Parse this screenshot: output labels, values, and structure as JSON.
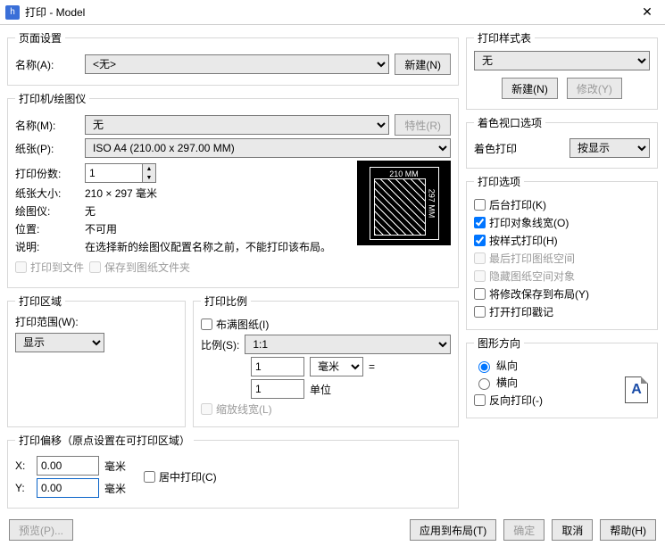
{
  "window": {
    "title": "打印 - Model",
    "icon": "h"
  },
  "page_setup": {
    "legend": "页面设置",
    "name_label": "名称(A):",
    "name_value": "<无>",
    "new_button": "新建(N)"
  },
  "printer": {
    "legend": "打印机/绘图仪",
    "name_label": "名称(M):",
    "name_value": "无",
    "properties_button": "特性(R)",
    "paper_label": "纸张(P):",
    "paper_value": "ISO A4 (210.00 x 297.00 MM)",
    "copies_label": "打印份数:",
    "copies_value": "1",
    "size_label": "纸张大小:",
    "size_value": "210 × 297  毫米",
    "plotter_label": "绘图仪:",
    "plotter_value": "无",
    "location_label": "位置:",
    "location_value": "不可用",
    "desc_label": "说明:",
    "desc_value": "在选择新的绘图仪配置名称之前，不能打印该布局。",
    "print_to_file": "打印到文件",
    "save_to_file": "保存到图纸文件夹",
    "preview_w": "210 MM",
    "preview_h": "297 MM"
  },
  "area": {
    "legend": "打印区域",
    "range_label": "打印范围(W):",
    "range_value": "显示"
  },
  "scale": {
    "legend": "打印比例",
    "fit": "布满图纸(I)",
    "ratio_label": "比例(S):",
    "ratio_value": "1:1",
    "num1": "1",
    "unit_mm": "毫米",
    "eq": "=",
    "num2": "1",
    "unit_label": "单位",
    "scale_lw": "缩放线宽(L)"
  },
  "offset": {
    "legend": "打印偏移（原点设置在可打印区域）",
    "x_label": "X:",
    "x_value": "0.00",
    "y_label": "Y:",
    "y_value": "0.00",
    "mm": "毫米",
    "center": "居中打印(C)"
  },
  "styles": {
    "legend": "打印样式表",
    "value": "无",
    "new_button": "新建(N)",
    "edit_button": "修改(Y)"
  },
  "viewport": {
    "legend": "着色视口选项",
    "label": "着色打印",
    "value": "按显示"
  },
  "options": {
    "legend": "打印选项",
    "o1": "后台打印(K)",
    "o2": "打印对象线宽(O)",
    "o3": "按样式打印(H)",
    "o4": "最后打印图纸空间",
    "o5": "隐藏图纸空间对象",
    "o6": "将修改保存到布局(Y)",
    "o7": "打开打印戳记"
  },
  "orient": {
    "legend": "图形方向",
    "portrait": "纵向",
    "landscape": "横向",
    "reverse": "反向打印(-)",
    "letter": "A"
  },
  "buttons": {
    "preview": "预览(P)...",
    "apply": "应用到布局(T)",
    "ok": "确定",
    "cancel": "取消",
    "help": "帮助(H)"
  }
}
